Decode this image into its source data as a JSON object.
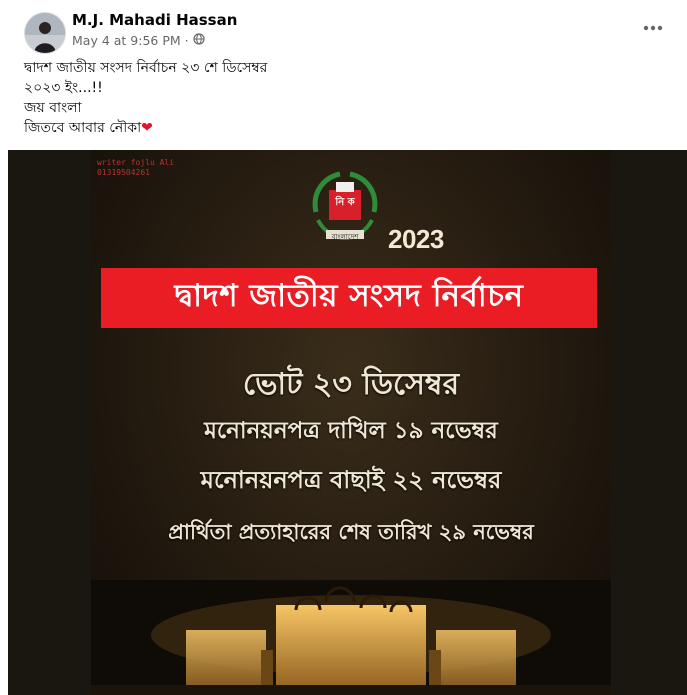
{
  "post": {
    "author": "M.J. Mahadi Hassan",
    "timestamp": "May 4 at 9:56 PM",
    "separator": "·",
    "privacy_icon": "globe-icon",
    "more_icon": "ellipsis-icon",
    "text_lines": [
      "দ্বাদশ জাতীয় সংসদ নির্বাচন ২৩ শে ডিসেম্বর",
      "২০২৩ ইং...!!",
      "জয় বাংলা",
      "জিতবে আবার নৌকা"
    ],
    "heart_emoji": "❤"
  },
  "image": {
    "writer_tag_line1": "writer fojlu Ali",
    "writer_tag_line2": "01319504261",
    "emblem_letters": "নি ক",
    "emblem_caption": "বাংলাদেশ",
    "year": "2023",
    "banner_text": "দ্বাদশ জাতীয় সংসদ নির্বাচন",
    "lines": [
      "ভোট ২৩ ডিসেম্বর",
      "মনোনয়নপত্র দাখিল ১৯ নভেম্বর",
      "মনোনয়নপত্র বাছাই ২২ নভেম্বর",
      "প্রার্থিতা প্রত্যাহারের শেষ তারিখ ২৯ নভেম্বর"
    ],
    "colors": {
      "banner": "#ea1c24",
      "background": "#1a1710",
      "text": "#efe6d4"
    }
  }
}
